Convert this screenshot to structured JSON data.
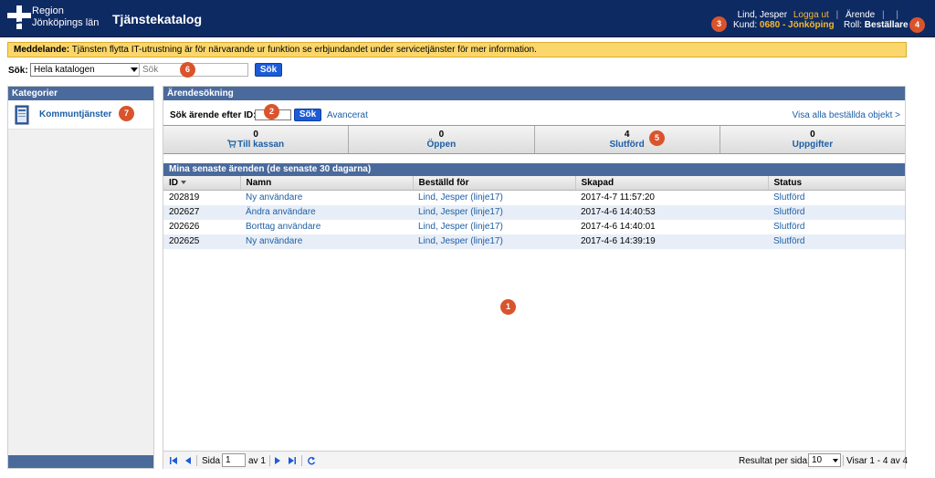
{
  "header": {
    "logo_line1": "Region",
    "logo_line2": "Jönköpings län",
    "title": "Tjänstekatalog",
    "user_name": "Lind, Jesper",
    "logout": "Logga ut",
    "case_link": "Ärende",
    "kund_label": "Kund:",
    "kund_value": "0680 - Jönköping",
    "roll_label": "Roll:",
    "roll_value": "Beställare"
  },
  "notice": {
    "label": "Meddelande:",
    "text": "Tjänsten flytta IT-utrustning är för närvarande ur funktion se erbjundandet under servicetjänster för mer information."
  },
  "search": {
    "label": "Sök:",
    "scope": "Hela katalogen",
    "placeholder": "Sök",
    "button": "Sök"
  },
  "sidebar": {
    "heading": "Kategorier",
    "items": [
      {
        "label": "Kommuntjänster"
      }
    ]
  },
  "main": {
    "heading": "Ärendesökning",
    "id_search_label": "Sök ärende efter ID:",
    "id_search_button": "Sök",
    "advanced": "Avancerat",
    "show_all": "Visa alla beställda objekt >",
    "stats": [
      {
        "count": "0",
        "label": "Till kassan"
      },
      {
        "count": "0",
        "label": "Öppen"
      },
      {
        "count": "4",
        "label": "Slutförd"
      },
      {
        "count": "0",
        "label": "Uppgifter"
      }
    ],
    "grid_title": "Mina senaste ärenden (de senaste 30 dagarna)",
    "columns": [
      "ID",
      "Namn",
      "Beställd för",
      "Skapad",
      "Status"
    ],
    "rows": [
      {
        "id": "202819",
        "name": "Ny användare",
        "for": "Lind, Jesper (linje17)",
        "created": "2017-4-7 11:57:20",
        "status": "Slutförd"
      },
      {
        "id": "202627",
        "name": "Ändra användare",
        "for": "Lind, Jesper (linje17)",
        "created": "2017-4-6 14:40:53",
        "status": "Slutförd"
      },
      {
        "id": "202626",
        "name": "Borttag användare",
        "for": "Lind, Jesper (linje17)",
        "created": "2017-4-6 14:40:01",
        "status": "Slutförd"
      },
      {
        "id": "202625",
        "name": "Ny användare",
        "for": "Lind, Jesper (linje17)",
        "created": "2017-4-6 14:39:19",
        "status": "Slutförd"
      }
    ]
  },
  "pager": {
    "page_label": "Sida",
    "page_value": "1",
    "of_label": "av 1",
    "rpp_label": "Resultat per sida:",
    "rpp_value": "10",
    "range": "Visar 1 - 4 av 4"
  },
  "markers": [
    "1",
    "2",
    "3",
    "4",
    "5",
    "6",
    "7"
  ],
  "colors": {
    "header_bg": "#0e2a63",
    "accent_orange": "#f5b92b",
    "panel_head": "#4a6a9c",
    "link_blue": "#1d5fa5",
    "button_blue": "#1c5bd8",
    "marker": "#d9542c",
    "notice_bg": "#fbd66a"
  }
}
